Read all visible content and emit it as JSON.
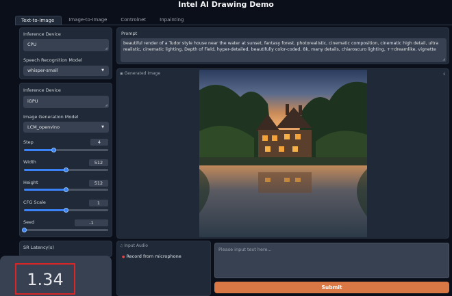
{
  "app": {
    "title": "Intel AI Drawing Demo"
  },
  "tabs": [
    "Text-to-Image",
    "Image-to-Image",
    "Controlnet",
    "Inpainting"
  ],
  "left": {
    "speech": {
      "device_label": "Inference Device",
      "device_value": "CPU",
      "model_label": "Speech Recognition Model",
      "model_value": "whisper-small"
    },
    "image": {
      "device_label": "Inference Device",
      "device_value": "iGPU",
      "model_label": "Image Generation Model",
      "model_value": "LCM_openvino"
    },
    "sliders": [
      {
        "label": "Step",
        "value": "4",
        "fraction": 0.35
      },
      {
        "label": "Width",
        "value": "512",
        "fraction": 0.5
      },
      {
        "label": "Height",
        "value": "512",
        "fraction": 0.5
      },
      {
        "label": "CFG Scale",
        "value": "1",
        "fraction": 0.5
      },
      {
        "label": "Seed",
        "value": "-1",
        "fraction": 0.0
      }
    ],
    "latency_label": "SR Latency(s)",
    "latency_value": "1.34"
  },
  "prompt": {
    "label": "Prompt",
    "text": "beautiful render of a Tudor style house near the water at sunset, fantasy forest. photorealistic, cinematic composition, cinematic high detail, ultra realistic, cinematic lighting, Depth of Field, hyper-detailed, beautifully color-coded, 8k, many details, chiaroscuro lighting, ++dreamlike, vignette"
  },
  "generated": {
    "label": "Generated Image"
  },
  "audio": {
    "label": "Input Audio",
    "record_label": "Record from microphone"
  },
  "text_input": {
    "placeholder": "Please input text here..."
  },
  "submit_label": "Submit"
}
